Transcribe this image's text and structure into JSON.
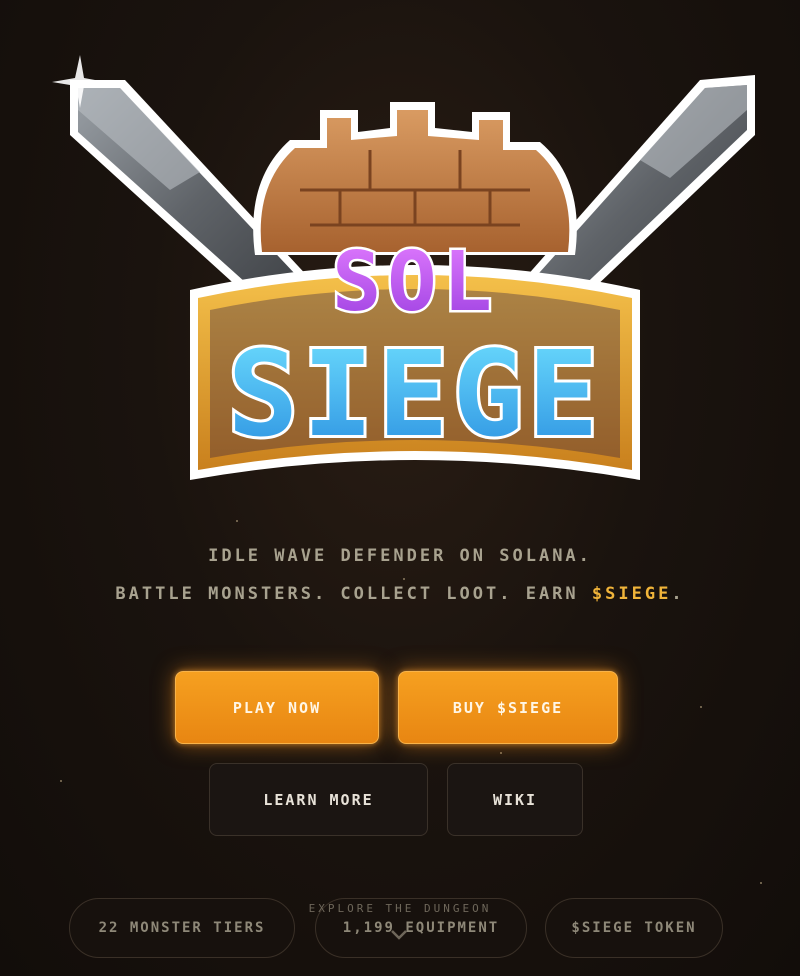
{
  "logo": {
    "line1": "SOL",
    "line2": "SIEGE"
  },
  "tagline": {
    "line1": "IDLE WAVE DEFENDER ON SOLANA.",
    "line2_prefix": "BATTLE MONSTERS. COLLECT LOOT. EARN ",
    "line2_highlight": "$SIEGE",
    "line2_suffix": "."
  },
  "buttons": {
    "play_now": "PLAY NOW",
    "buy_siege": "BUY $SIEGE",
    "learn_more": "LEARN MORE",
    "wiki": "WIKI"
  },
  "features": [
    {
      "label": "22 MONSTER TIERS"
    },
    {
      "label": "1,199 EQUIPMENT"
    },
    {
      "label": "$SIEGE TOKEN"
    }
  ],
  "scroll_hint": "EXPLORE THE DUNGEON",
  "colors": {
    "accent": "#f6a020",
    "highlight": "#f0b43a",
    "background": "#15100c",
    "logo_purple": "#c35cf5",
    "logo_blue": "#3ec4f4",
    "logo_gold": "#e9a534",
    "tower": "#c07a45"
  },
  "icons": {
    "scroll_down": "chevron-down-icon"
  }
}
